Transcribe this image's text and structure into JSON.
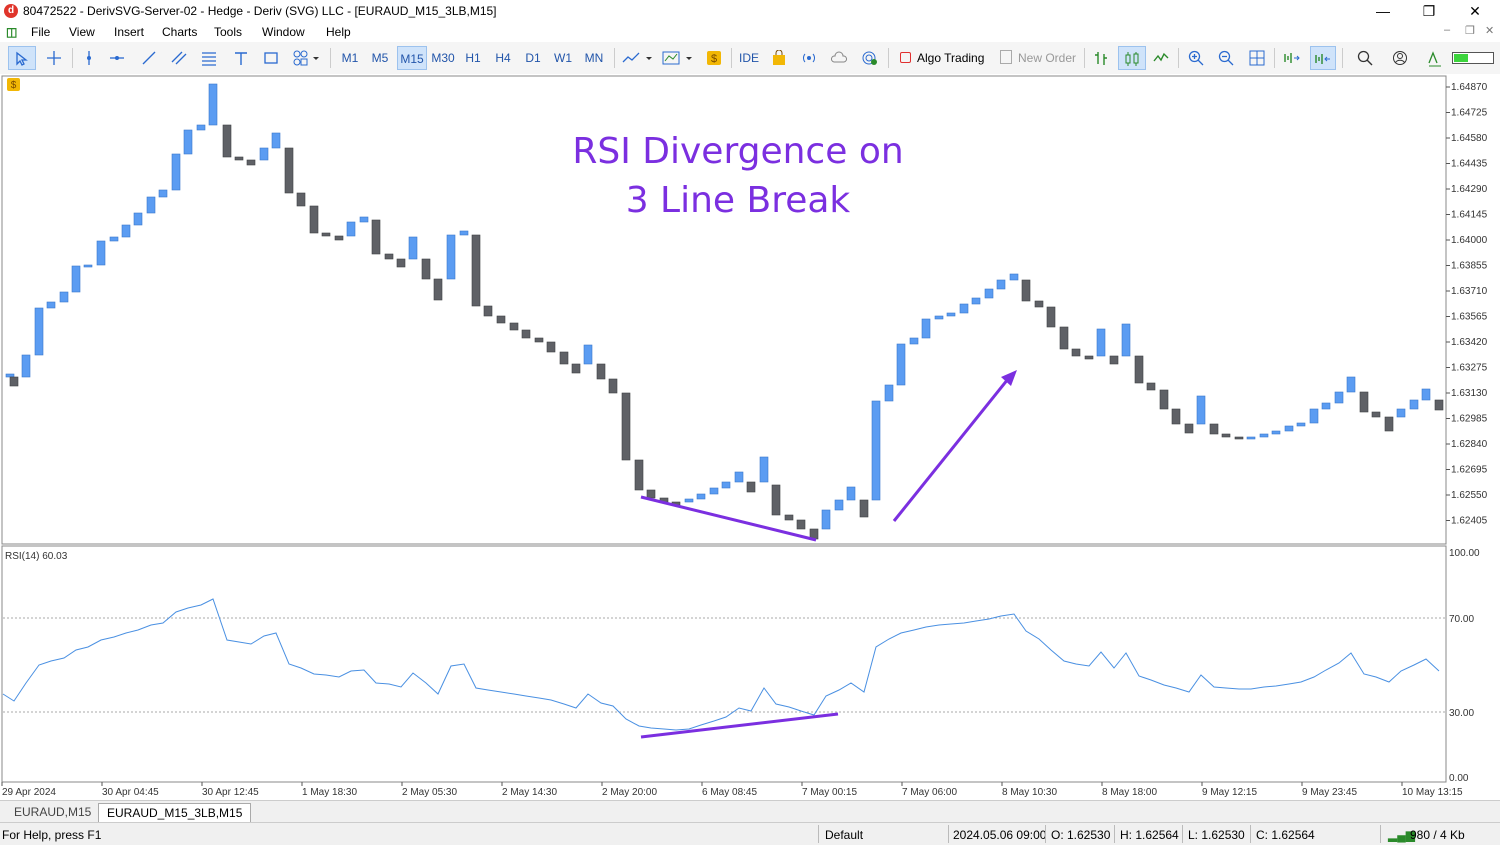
{
  "window": {
    "title": "80472522 - DerivSVG-Server-02 - Hedge - Deriv (SVG) LLC - [EURAUD_M15_3LB,M15]",
    "minimize": "—",
    "maximize": "❐",
    "close": "✕"
  },
  "menu": [
    "File",
    "View",
    "Insert",
    "Charts",
    "Tools",
    "Window",
    "Help"
  ],
  "toolbar": {
    "timeframes": [
      "M1",
      "M5",
      "M15",
      "M30",
      "H1",
      "H4",
      "D1",
      "W1",
      "MN"
    ],
    "selected_timeframe": "M15",
    "ide": "IDE",
    "algo_trading": "Algo Trading",
    "new_order": "New Order"
  },
  "chart": {
    "annotation_line1": "RSI Divergence on",
    "annotation_line2": "3 Line Break",
    "price_labels": [
      "1.64870",
      "1.64725",
      "1.64580",
      "1.64435",
      "1.64290",
      "1.64145",
      "1.64000",
      "1.63855",
      "1.63710",
      "1.63565",
      "1.63420",
      "1.63275",
      "1.63130",
      "1.62985",
      "1.62840",
      "1.62695",
      "1.62550",
      "1.62405"
    ],
    "rsi_label": "RSI(14) 60.03",
    "rsi_levels": [
      "100.00",
      "70.00",
      "30.00",
      "0.00"
    ],
    "time_labels": [
      "29 Apr 2024",
      "30 Apr 04:45",
      "30 Apr 12:45",
      "1 May 18:30",
      "2 May 05:30",
      "2 May 14:30",
      "2 May 20:00",
      "6 May 08:45",
      "7 May 00:15",
      "7 May 06:00",
      "8 May 10:30",
      "8 May 18:00",
      "9 May 12:15",
      "9 May 23:45",
      "10 May 13:15"
    ],
    "colors": {
      "up": "#5b9cf2",
      "down": "#5f6166",
      "rsi": "#4a90e2",
      "annotation": "#7b2fe0"
    }
  },
  "tabs": [
    "EURAUD,M15",
    "EURAUD_M15_3LB,M15"
  ],
  "active_tab": "EURAUD_M15_3LB,M15",
  "status": {
    "help": "For Help, press F1",
    "profile": "Default",
    "datetime": "2024.05.06 09:00",
    "open": "O: 1.62530",
    "high": "H: 1.62564",
    "low": "L: 1.62530",
    "close": "C: 1.62564",
    "traffic": "980 / 4 Kb"
  }
}
